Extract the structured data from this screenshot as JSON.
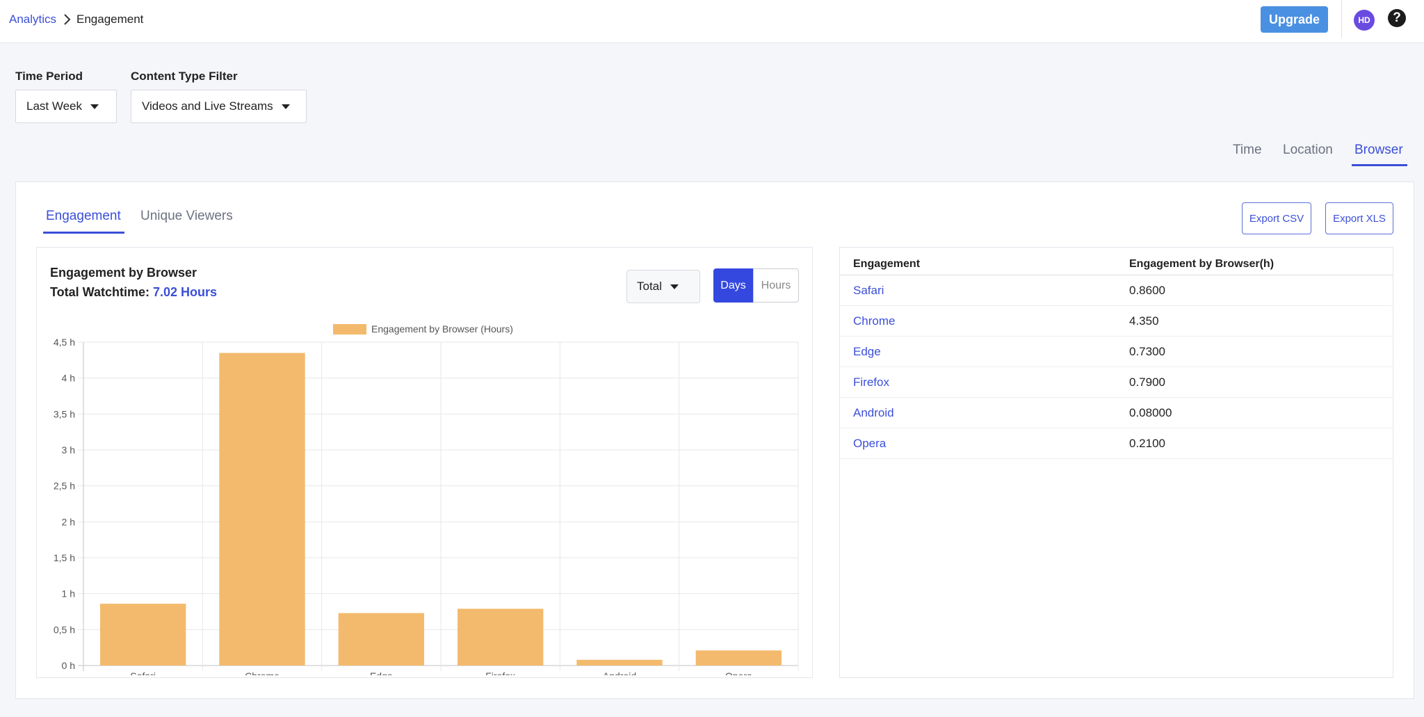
{
  "breadcrumb": {
    "parent": "Analytics",
    "current": "Engagement"
  },
  "header": {
    "upgrade_label": "Upgrade",
    "avatar_initials": "HD",
    "help_glyph": "?"
  },
  "filters": {
    "time_period": {
      "label": "Time Period",
      "value": "Last Week"
    },
    "content_type": {
      "label": "Content Type Filter",
      "value": "Videos and Live Streams"
    }
  },
  "view_tabs": [
    "Time",
    "Location",
    "Browser"
  ],
  "view_tab_active": "Browser",
  "sub_tabs": [
    "Engagement",
    "Unique Viewers"
  ],
  "sub_tab_active": "Engagement",
  "exports": {
    "csv": "Export CSV",
    "xls": "Export XLS"
  },
  "chart_panel": {
    "title": "Engagement by Browser",
    "total_label": "Total Watchtime:",
    "total_value": "7.02 Hours",
    "aggregate_select": "Total",
    "segment": {
      "days": "Days",
      "hours": "Hours",
      "active": "Days"
    }
  },
  "chart_data": {
    "type": "bar",
    "categories": [
      "Safari",
      "Chrome",
      "Edge",
      "Firefox",
      "Android",
      "Opera"
    ],
    "series": [
      {
        "name": "Engagement by Browser (Hours)",
        "values": [
          0.86,
          4.35,
          0.73,
          0.79,
          0.08,
          0.21
        ],
        "color": "#f3ba6d"
      }
    ],
    "ylim": [
      0,
      4.5
    ],
    "yticks": [
      "0 h",
      "0,5 h",
      "1 h",
      "1,5 h",
      "2 h",
      "2,5 h",
      "3 h",
      "3,5 h",
      "4 h",
      "4,5 h"
    ],
    "grid": true,
    "legend": "top-center"
  },
  "table": {
    "headers": [
      "Engagement",
      "Engagement by Browser(h)"
    ],
    "rows": [
      {
        "name": "Safari",
        "value": "0.8600"
      },
      {
        "name": "Chrome",
        "value": "4.350"
      },
      {
        "name": "Edge",
        "value": "0.7300"
      },
      {
        "name": "Firefox",
        "value": "0.7900"
      },
      {
        "name": "Android",
        "value": "0.08000"
      },
      {
        "name": "Opera",
        "value": "0.2100"
      }
    ]
  }
}
